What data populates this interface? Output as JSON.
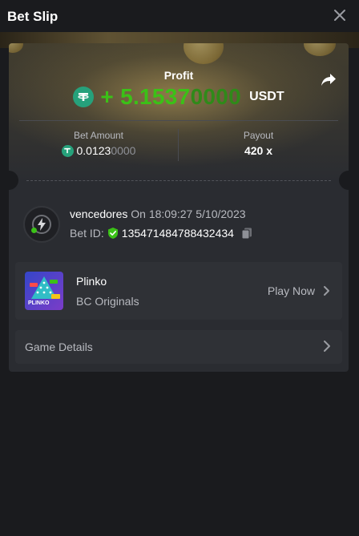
{
  "header": {
    "title": "Bet Slip"
  },
  "profit": {
    "label": "Profit",
    "sign": "+",
    "value_main": "5.1537",
    "value_dim": "0000",
    "currency": "USDT"
  },
  "bet_amount": {
    "label": "Bet Amount",
    "value_main": "0.0123",
    "value_dim": "0000"
  },
  "payout": {
    "label": "Payout",
    "value": "420 x"
  },
  "player": {
    "name": "vencedores",
    "timestamp": "On 18:09:27 5/10/2023",
    "bet_id_label": "Bet ID:",
    "bet_id": "135471484788432434"
  },
  "game": {
    "name": "Plinko",
    "provider": "BC Originals",
    "action": "Play Now",
    "thumb_text": "PLINKO"
  },
  "details": {
    "label": "Game Details"
  },
  "colors": {
    "profit_green": "#3bc117",
    "tether_green": "#26a17b",
    "background": "#1a1b1e",
    "card": "#2a2c31"
  }
}
